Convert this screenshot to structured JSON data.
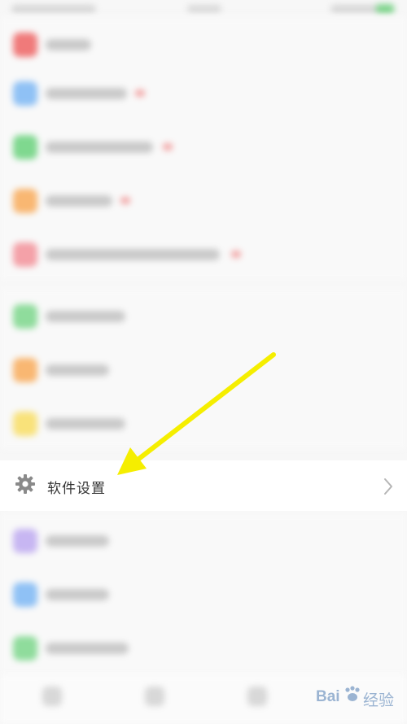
{
  "settings_row": {
    "label": "软件设置"
  },
  "watermark": {
    "left": "Bai",
    "right": "经验"
  },
  "colors": {
    "highlight_arrow": "#f5ee00",
    "row_icons": [
      "#f07a7a",
      "#8fc1f5",
      "#7fd88f",
      "#f9b772",
      "#f4a1a8",
      "#8fdc9c",
      "#f9b772",
      "#f9e27a",
      "#c7b6f2",
      "#8fc1f5",
      "#8fdc9c"
    ]
  }
}
